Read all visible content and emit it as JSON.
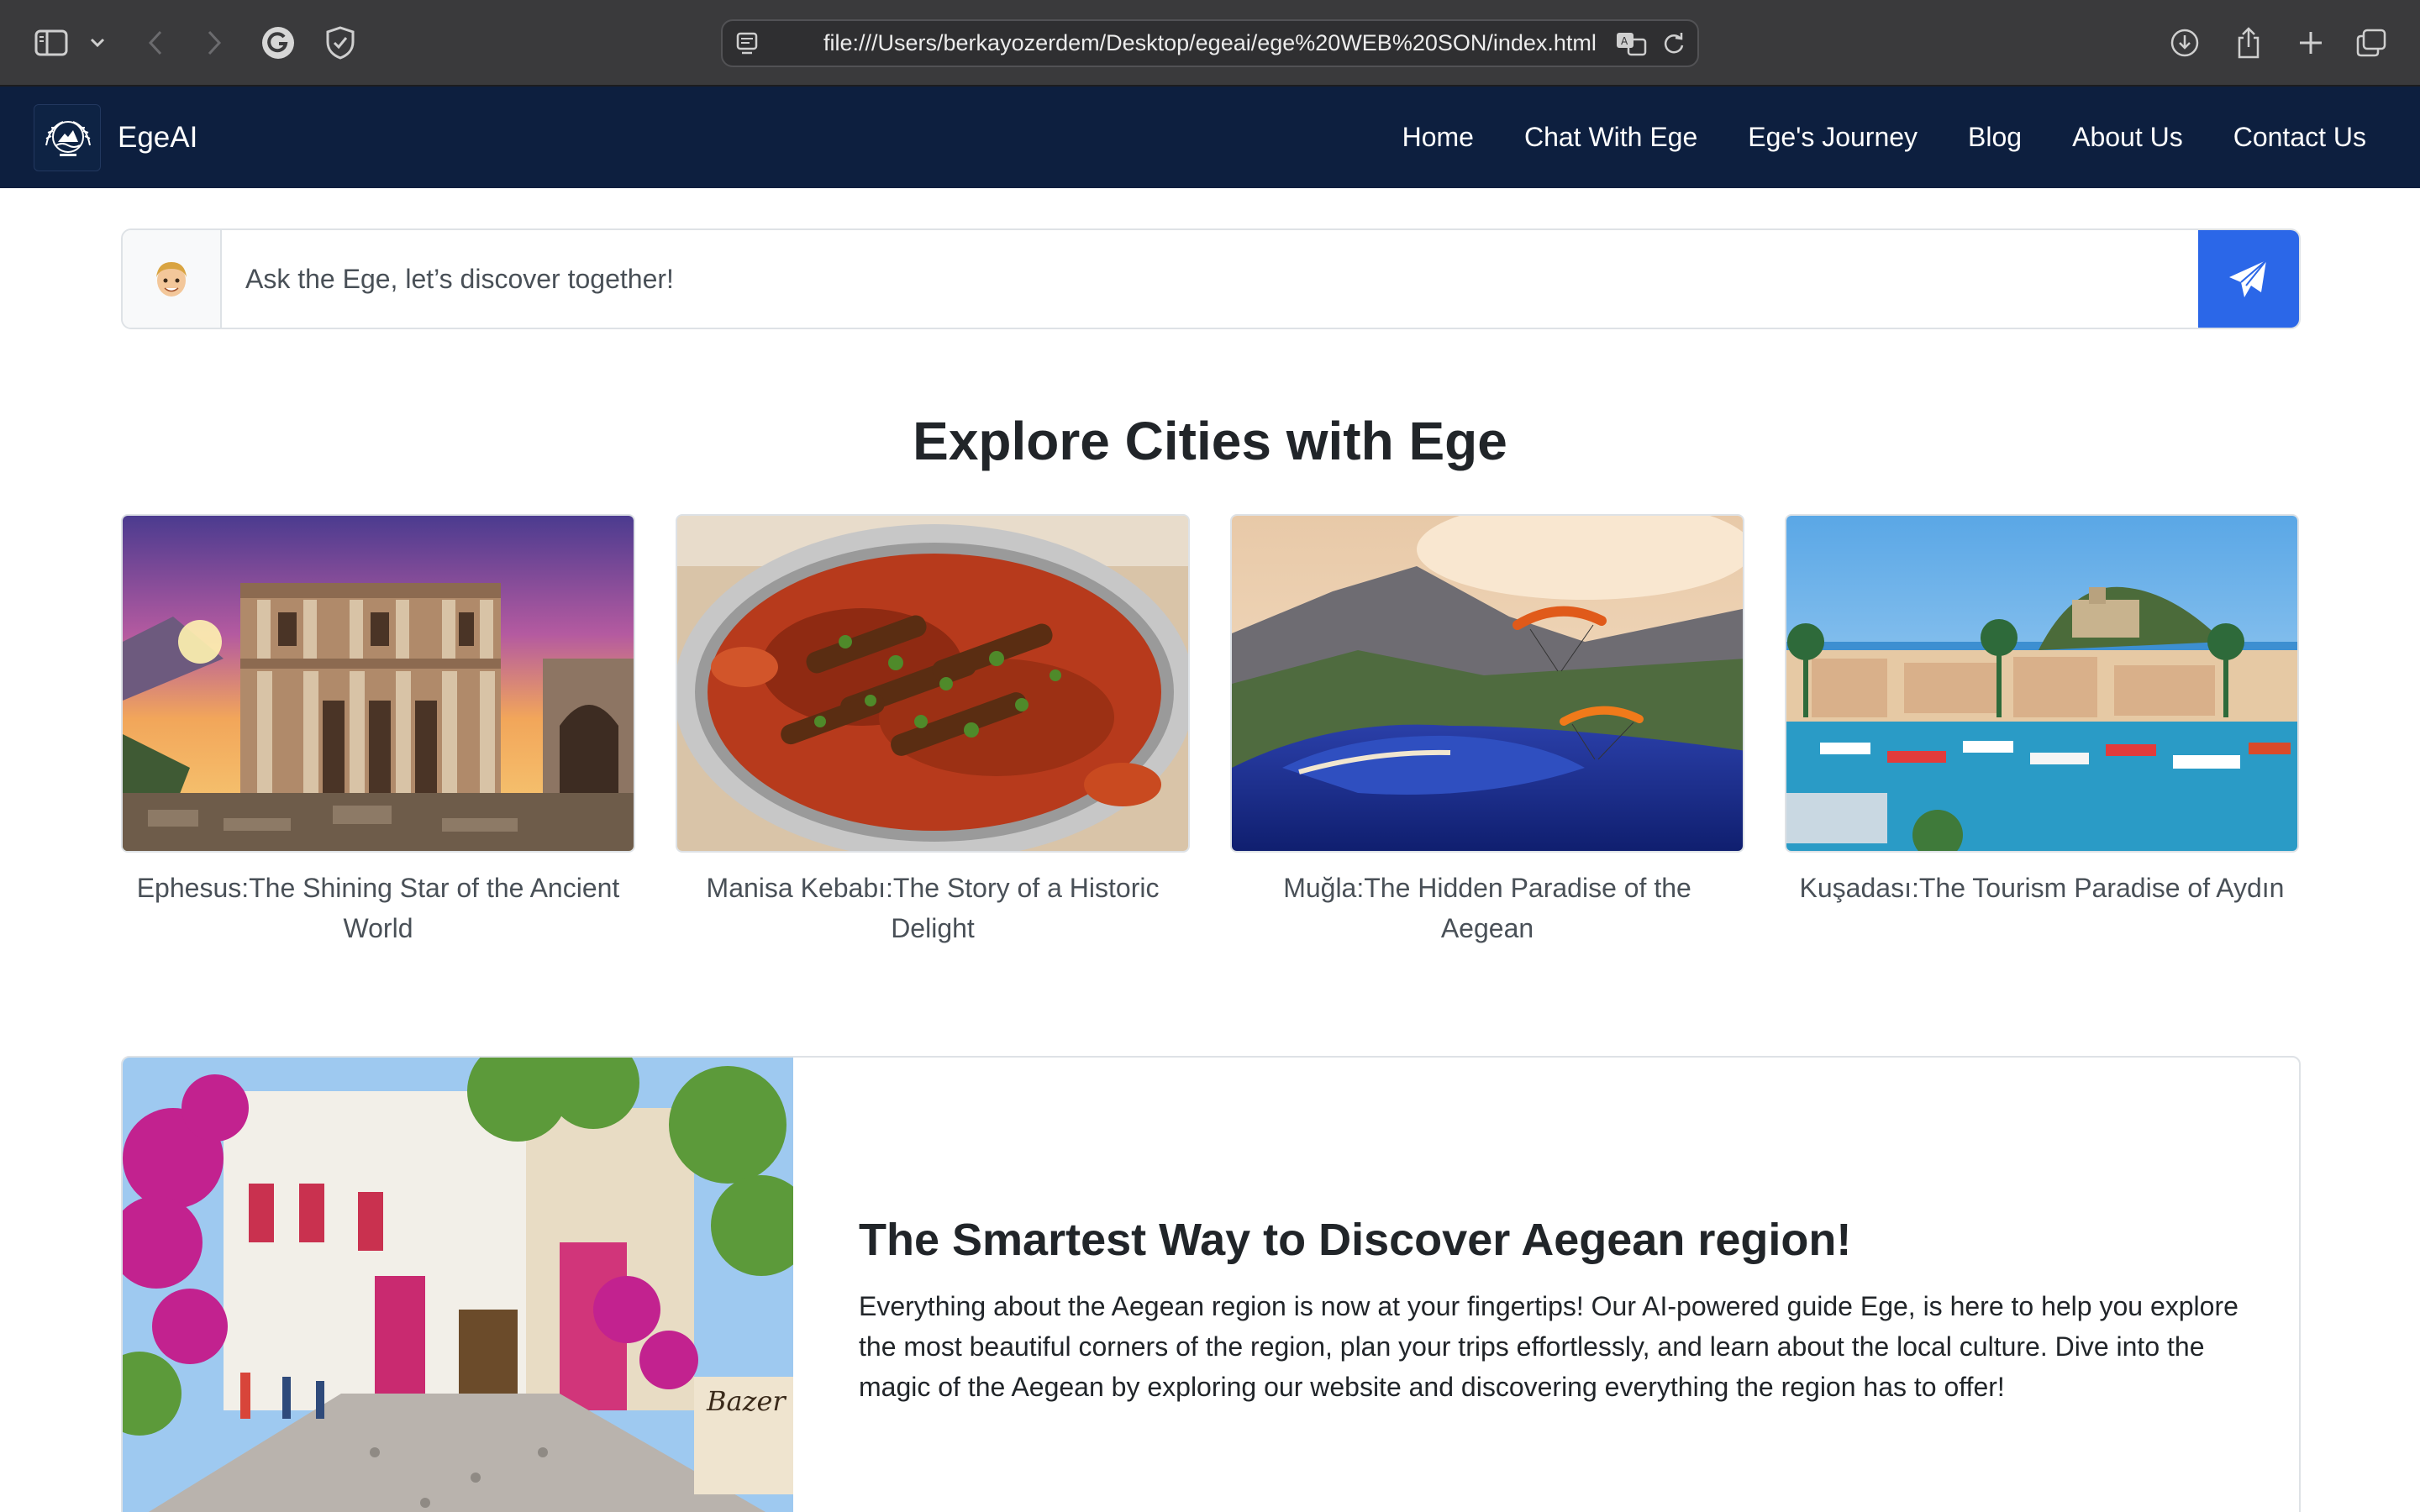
{
  "browser": {
    "url": "file:///Users/berkayozerdem/Desktop/egeai/ege%20WEB%20SON/index.html",
    "icons": [
      "sidebar-icon",
      "chevron-down-icon",
      "back-icon",
      "forward-icon",
      "grammarly-icon",
      "shield-icon",
      "page-icon",
      "translate-icon",
      "reload-icon",
      "download-icon",
      "share-icon",
      "new-tab-icon",
      "tab-overview-icon"
    ]
  },
  "navbar": {
    "brand": "EgeAI",
    "links": [
      "Home",
      "Chat With Ege",
      "Ege's Journey",
      "Blog",
      "About Us",
      "Contact Us"
    ]
  },
  "search": {
    "placeholder": "Ask the Ege, let’s discover together!",
    "avatar_icon": "memoji-avatar-icon",
    "send_icon": "paper-plane-icon"
  },
  "explore": {
    "title": "Explore Cities with Ege",
    "cards": [
      {
        "caption": "Ephesus:The Shining Star of the Ancient World"
      },
      {
        "caption": "Manisa Kebabı:The Story of a Historic Delight"
      },
      {
        "caption": "Muğla:The Hidden Paradise of the Aegean"
      },
      {
        "caption": "Kuşadası:The Tourism Paradise of Aydın"
      }
    ]
  },
  "feature": {
    "title": "The Smartest Way to Discover Aegean region!",
    "text": "Everything about the Aegean region is now at your fingertips! Our AI-powered guide Ege, is here to help you explore the most beautiful corners of the region, plan your trips effortlessly, and learn about the local culture. Dive into the magic of the Aegean by exploring our website and discovering everything the region has to offer!"
  },
  "colors": {
    "navbar_bg": "#0d1f3f",
    "accent": "#2b67e8",
    "chrome_bg": "#3a3a3c"
  }
}
